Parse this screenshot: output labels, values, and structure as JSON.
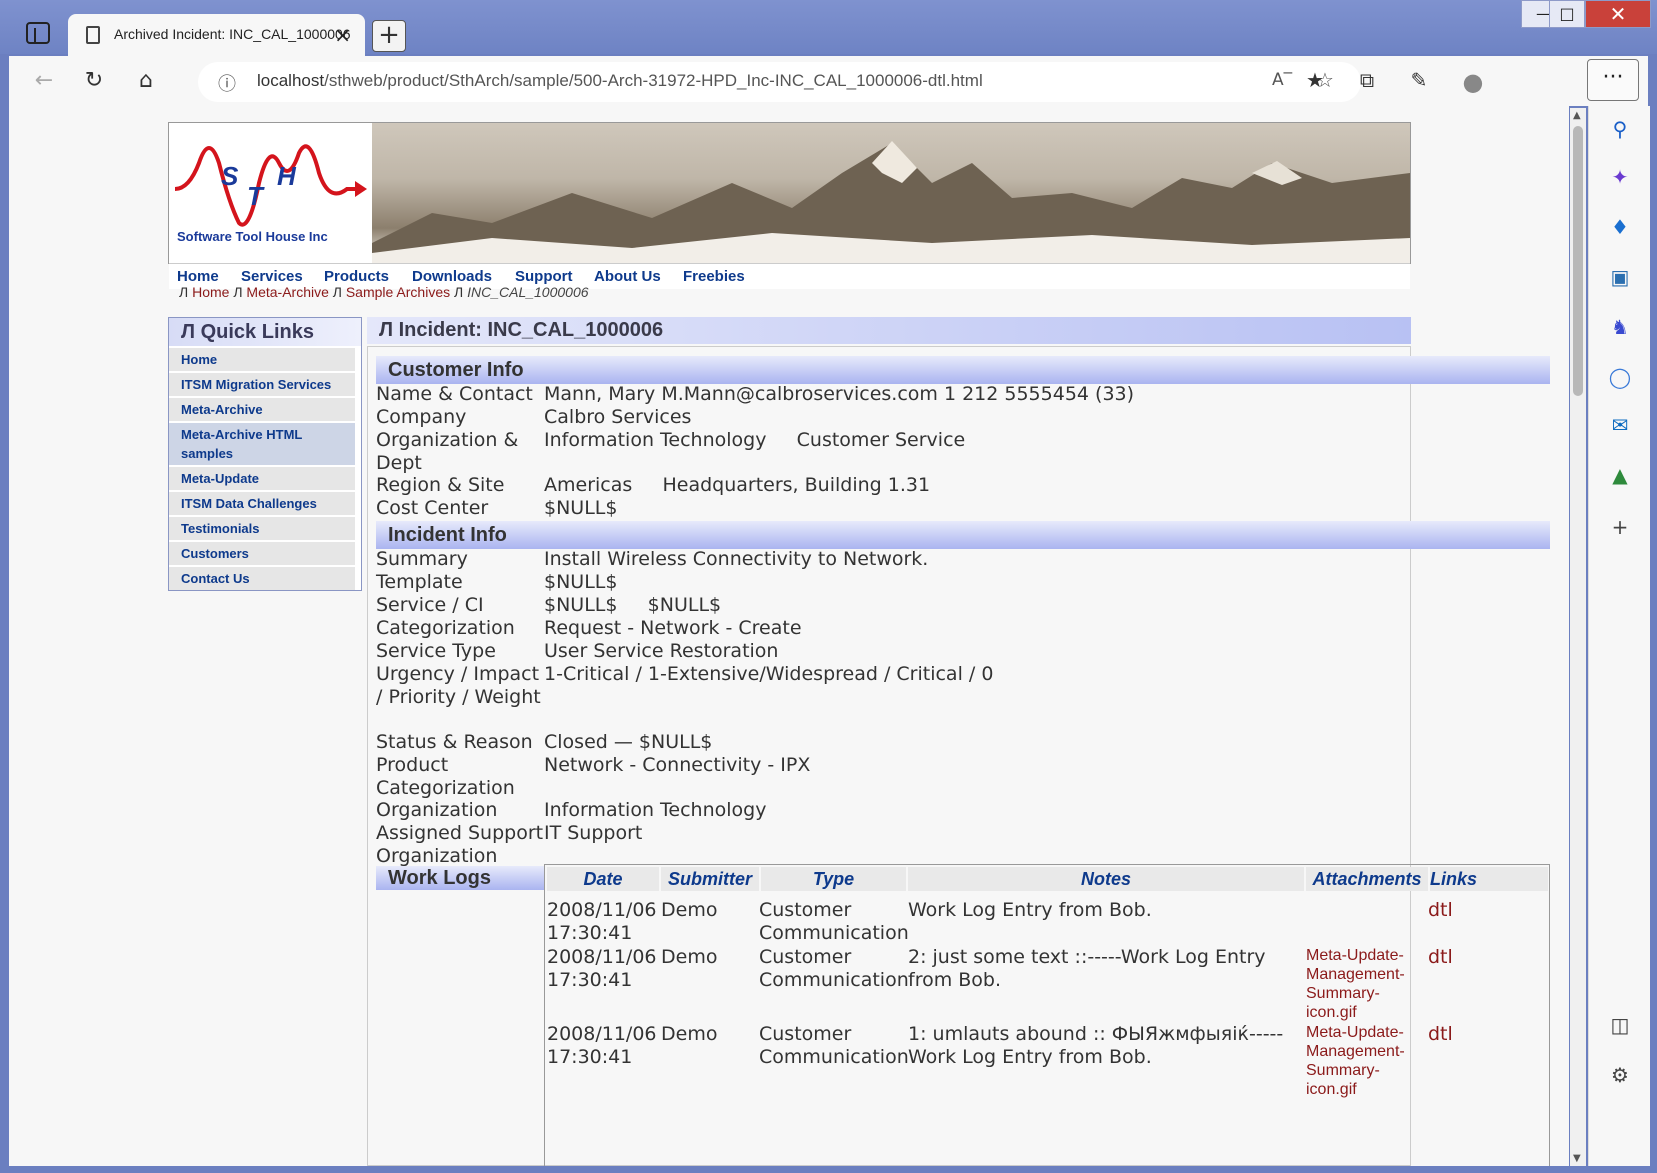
{
  "browser": {
    "tab_title": "Archived Incident: INC_CAL_1000006",
    "url_host": "localhost",
    "url_path": "/sthweb/product/SthArch/sample/500-Arch-31972-HPD_Inc-INC_CAL_1000006-dtl.html",
    "new_tab": "+",
    "close_tab": "×",
    "menu": "···"
  },
  "site": {
    "logo_text": "Software Tool House Inc",
    "nav": [
      "Home",
      "Services",
      "Products",
      "Downloads",
      "Support",
      "About Us",
      "Freebies"
    ]
  },
  "breadcrumb": {
    "sep": "Л",
    "items": [
      "Home",
      "Meta-Archive",
      "Sample Archives"
    ],
    "current": "INC_CAL_1000006"
  },
  "quick_links": {
    "title": "Л Quick Links",
    "items": [
      "Home",
      "ITSM Migration Services",
      "Meta-Archive",
      "Meta-Archive HTML samples",
      "Meta-Update",
      "ITSM Data Challenges",
      "Testimonials",
      "Customers",
      "Contact Us"
    ]
  },
  "incident": {
    "title": "Л Incident: INC_CAL_1000006",
    "customer_info_title": "Customer Info",
    "customer": [
      {
        "k": "Name & Contact",
        "v": "Mann, Mary M.Mann@calbroservices.com 1 212 5555454 (33)"
      },
      {
        "k": "Company",
        "v": "Calbro Services"
      },
      {
        "k": "Organization & Dept",
        "v": "Information Technology     Customer Service"
      },
      {
        "k": "Region & Site",
        "v": "Americas     Headquarters, Building 1.31"
      },
      {
        "k": "Cost Center",
        "v": "$NULL$"
      }
    ],
    "incident_info_title": "Incident Info",
    "info": [
      {
        "k": "Summary",
        "v": "Install Wireless Connectivity to Network."
      },
      {
        "k": "Template",
        "v": "$NULL$"
      },
      {
        "k": "Service / CI",
        "v": "$NULL$     $NULL$"
      },
      {
        "k": "Categorization",
        "v": "Request - Network - Create"
      },
      {
        "k": "Service Type",
        "v": "User Service Restoration"
      },
      {
        "k": "Urgency / Impact / Priority / Weight",
        "v": "1-Critical / 1-Extensive/Widespread / Critical / 0"
      },
      {
        "k": "Status & Reason",
        "v": "Closed — $NULL$"
      },
      {
        "k": "Product Categorization",
        "v": "Network - Connectivity - IPX"
      },
      {
        "k": "Organization",
        "v": "Information Technology"
      },
      {
        "k": "Assigned Support Organization",
        "v": "IT Support"
      }
    ]
  },
  "worklogs": {
    "title": "Work Logs",
    "headers": [
      "Date",
      "Submitter",
      "Type",
      "Notes",
      "Attachments",
      "Links"
    ],
    "rows": [
      {
        "date1": "2008/11/06",
        "date2": "17:30:41",
        "submitter": "Demo",
        "type1": "Customer",
        "type2": "Communication",
        "notes1": "Work Log Entry from Bob.",
        "notes2": "",
        "attachment": "",
        "link": "dtl"
      },
      {
        "date1": "2008/11/06",
        "date2": "17:30:41",
        "submitter": "Demo",
        "type1": "Customer",
        "type2": "Communication",
        "notes1": "2: just some text ::-----Work Log Entry",
        "notes2": "from Bob.",
        "attachment": "Meta-Update-Management-Summary-icon.gif",
        "link": "dtl"
      },
      {
        "date1": "2008/11/06",
        "date2": "17:30:41",
        "submitter": "Demo",
        "type1": "Customer",
        "type2": "Communication",
        "notes1": "1: umlauts abound :: ФЫЯжмфыяiќ-----",
        "notes2": "Work Log Entry from Bob.",
        "attachment": "Meta-Update-Management-Summary-icon.gif",
        "link": "dtl"
      }
    ]
  }
}
